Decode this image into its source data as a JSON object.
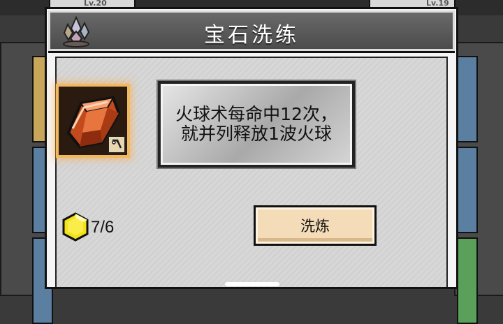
{
  "background": {
    "left_card_level": "Lv.20",
    "right_card_level": "Lv.19"
  },
  "modal": {
    "title": "宝石洗练"
  },
  "gem": {
    "icon": "orange-crystal-gem-icon",
    "badge_icon": "sword-badge-icon"
  },
  "description": {
    "text": "火球术每命中12次，就并列释放1波火球"
  },
  "cost": {
    "icon": "yellow-hexagon-gem-icon",
    "text": "7/6"
  },
  "refine_button": {
    "label": "洗炼"
  },
  "colors": {
    "header_bg": "#5a5a5a",
    "gem_glow": "#f0b860",
    "button_bg": "#f5dcb8",
    "cost_icon": "#f2e21a"
  }
}
